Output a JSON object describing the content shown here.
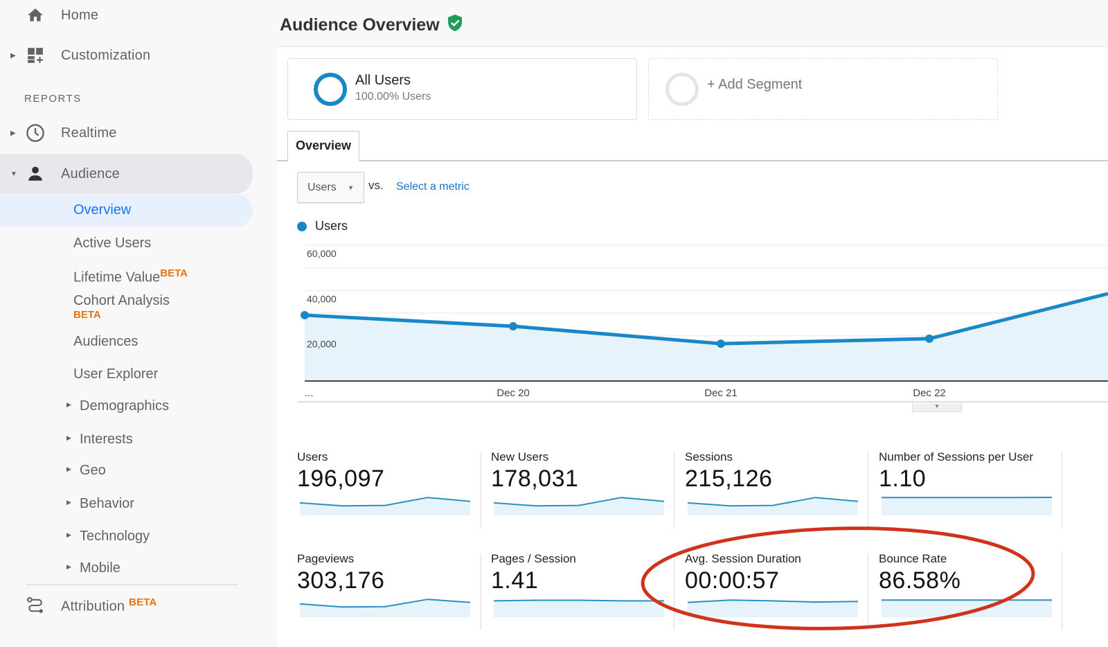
{
  "sidebar": {
    "home": {
      "label": "Home",
      "icon": "home-icon"
    },
    "customization": {
      "label": "Customization",
      "icon": "dashboard-customize-icon"
    },
    "reports_label": "REPORTS",
    "realtime": {
      "label": "Realtime",
      "icon": "clock-icon"
    },
    "audience": {
      "label": "Audience",
      "icon": "person-icon",
      "expanded": true
    },
    "audience_items": [
      {
        "label": "Overview",
        "selected": true
      },
      {
        "label": "Active Users"
      },
      {
        "label": "Lifetime Value",
        "badge": "BETA"
      },
      {
        "label": "Cohort Analysis",
        "badge": "BETA"
      },
      {
        "label": "Audiences"
      },
      {
        "label": "User Explorer"
      },
      {
        "label": "Demographics",
        "expandable": true
      },
      {
        "label": "Interests",
        "expandable": true
      },
      {
        "label": "Geo",
        "expandable": true
      },
      {
        "label": "Behavior",
        "expandable": true
      },
      {
        "label": "Technology",
        "expandable": true
      },
      {
        "label": "Mobile",
        "expandable": true
      }
    ],
    "attribution": {
      "label": "Attribution",
      "badge": "BETA",
      "icon": "attribution-route-icon"
    }
  },
  "header": {
    "title": "Audience Overview",
    "verified_icon": "verified-shield-icon"
  },
  "segments": {
    "active": {
      "name": "All Users",
      "detail": "100.00% Users"
    },
    "add_label": "+ Add Segment"
  },
  "tabs": [
    {
      "label": "Overview",
      "active": true
    }
  ],
  "metric_picker": {
    "selected": "Users",
    "vs_label": "vs.",
    "compare_link": "Select a metric"
  },
  "colors": {
    "accent": "#1a87c6",
    "area_fill": "#e6f3fa",
    "link": "#1a73c8",
    "beta": "#e8710a",
    "annotation": "#d0321c",
    "verified": "#1e9e5a"
  },
  "chart_data": {
    "type": "area",
    "title": "",
    "legend": [
      "Users"
    ],
    "legend_position": "top-left",
    "x": [
      "…",
      "Dec 20",
      "Dec 21",
      "Dec 22",
      ""
    ],
    "x_tick_labels": [
      "...",
      "Dec 20",
      "Dec 21",
      "Dec 22"
    ],
    "series": [
      {
        "name": "Users",
        "values": [
          29100,
          24200,
          16500,
          18700,
          38600
        ]
      }
    ],
    "y_tick_labels": [
      "60,000",
      "40,000",
      "20,000"
    ],
    "ylim": [
      0,
      60000
    ],
    "grid": true,
    "xlabel": "",
    "ylabel": ""
  },
  "metrics": [
    {
      "label": "Users",
      "value": "196,097",
      "spark": [
        0.55,
        0.35,
        0.38,
        0.9,
        0.65
      ]
    },
    {
      "label": "New Users",
      "value": "178,031",
      "spark": [
        0.55,
        0.35,
        0.38,
        0.9,
        0.65
      ]
    },
    {
      "label": "Sessions",
      "value": "215,126",
      "spark": [
        0.55,
        0.35,
        0.38,
        0.9,
        0.65
      ]
    },
    {
      "label": "Number of Sessions per User",
      "value": "1.10",
      "spark": [
        0.9,
        0.9,
        0.9,
        0.9,
        0.91
      ]
    },
    {
      "label": "Pageviews",
      "value": "303,176",
      "spark": [
        0.6,
        0.4,
        0.42,
        0.9,
        0.7
      ]
    },
    {
      "label": "Pages / Session",
      "value": "1.41",
      "spark": [
        0.8,
        0.84,
        0.84,
        0.8,
        0.8
      ]
    },
    {
      "label": "Avg. Session Duration",
      "value": "00:00:57",
      "spark": [
        0.7,
        0.85,
        0.8,
        0.72,
        0.76
      ]
    },
    {
      "label": "Bounce Rate",
      "value": "86.58%",
      "spark": [
        0.85,
        0.85,
        0.85,
        0.85,
        0.85
      ]
    }
  ],
  "annotation": {
    "shape": "ellipse",
    "highlights": [
      "Avg. Session Duration",
      "Bounce Rate"
    ]
  }
}
